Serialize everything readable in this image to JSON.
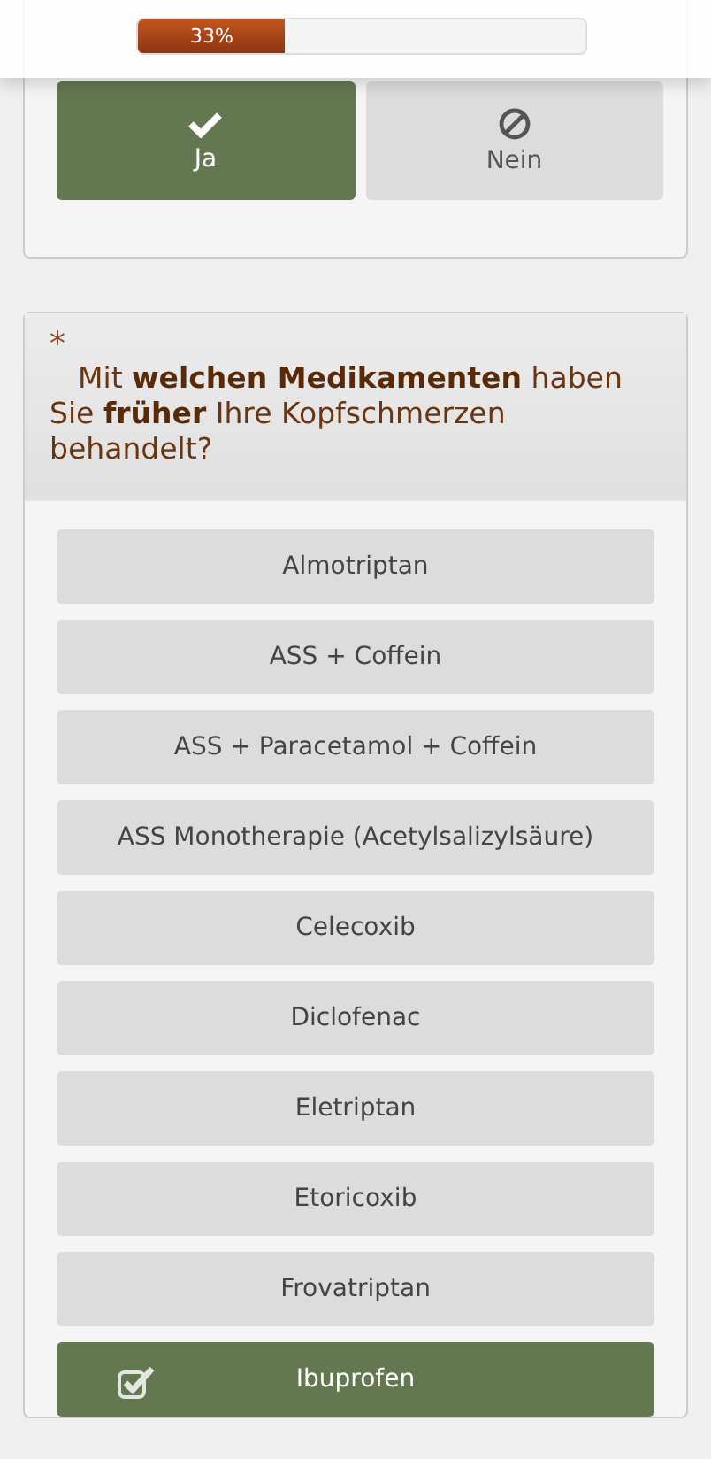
{
  "progress": {
    "label": "33%",
    "level": 0.33
  },
  "yes_no": [
    {
      "label": "Ja",
      "kind": "yes",
      "selected": true
    },
    {
      "label": "Nein",
      "kind": "no",
      "selected": false
    }
  ],
  "question": {
    "required_mark": "*",
    "text": "Mit **welchen Medikamenten** haben Sie **früher** Ihre Kopfschmerzen behandelt?"
  },
  "options": [
    {
      "label": "Almotriptan",
      "checked": false
    },
    {
      "label": "ASS + Coffein",
      "checked": false
    },
    {
      "label": "ASS + Paracetamol + Coffein",
      "checked": false
    },
    {
      "label": "ASS Monotherapie (Acetylsalizylsäure)",
      "checked": false
    },
    {
      "label": "Celecoxib",
      "checked": false
    },
    {
      "label": "Diclofenac",
      "checked": false
    },
    {
      "label": "Eletriptan",
      "checked": false
    },
    {
      "label": "Etoricoxib",
      "checked": false
    },
    {
      "label": "Frovatriptan",
      "checked": false
    },
    {
      "label": "Ibuprofen",
      "checked": true
    }
  ]
}
